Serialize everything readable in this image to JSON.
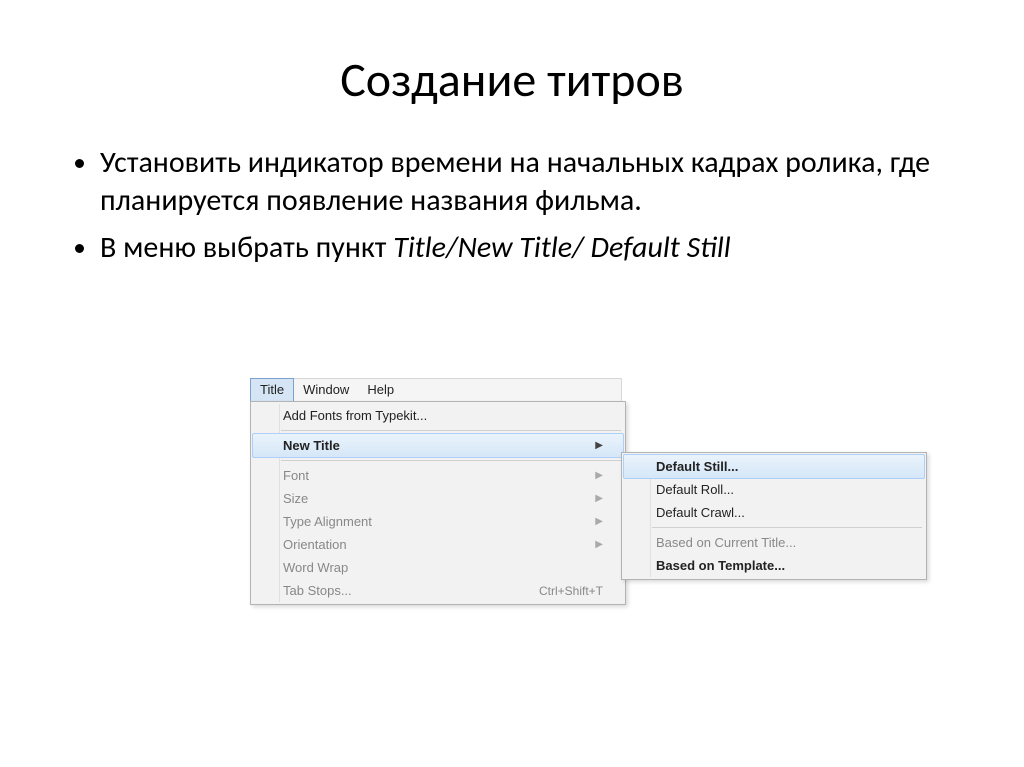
{
  "slide": {
    "title": "Создание титров",
    "bullets": [
      {
        "text": "Установить индикатор времени на начальных кадрах ролика, где планируется появление названия фильма."
      },
      {
        "prefix": "В меню выбрать пункт ",
        "italic": "Title/New Title/ Default Still"
      }
    ]
  },
  "menubar": {
    "items": [
      "Title",
      "Window",
      "Help"
    ]
  },
  "dropdown": {
    "items": [
      {
        "label": "Add Fonts from Typekit...",
        "type": "item"
      },
      {
        "type": "sep"
      },
      {
        "label": "New Title",
        "type": "submenu",
        "highlight": true
      },
      {
        "type": "sep"
      },
      {
        "label": "Font",
        "type": "submenu",
        "disabled": true
      },
      {
        "label": "Size",
        "type": "submenu",
        "disabled": true
      },
      {
        "label": "Type Alignment",
        "type": "submenu",
        "disabled": true
      },
      {
        "label": "Orientation",
        "type": "submenu",
        "disabled": true
      },
      {
        "label": "Word Wrap",
        "type": "item",
        "disabled": true
      },
      {
        "label": "Tab Stops...",
        "type": "item",
        "disabled": true,
        "shortcut": "Ctrl+Shift+T"
      }
    ]
  },
  "submenu": {
    "items": [
      {
        "label": "Default Still...",
        "highlight": true
      },
      {
        "label": "Default Roll..."
      },
      {
        "label": "Default Crawl..."
      },
      {
        "type": "sep"
      },
      {
        "label": "Based on Current Title...",
        "disabled": true
      },
      {
        "label": "Based on Template...",
        "bold": true
      }
    ]
  }
}
